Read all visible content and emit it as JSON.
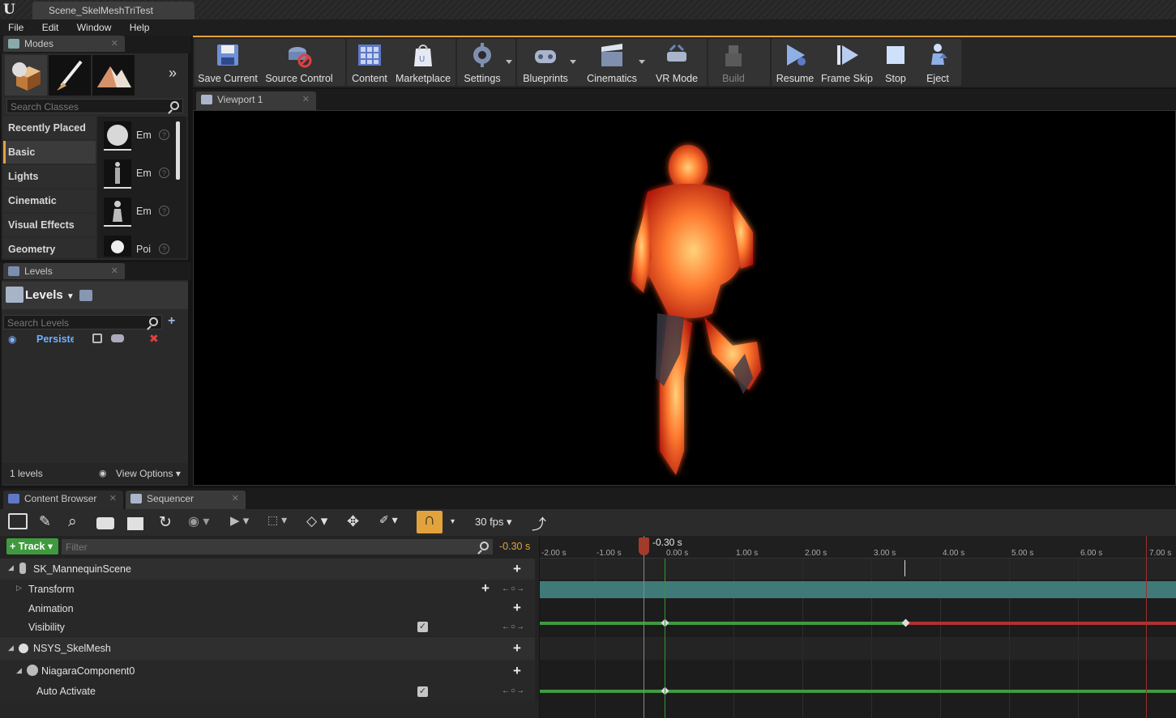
{
  "app": {
    "title": "Scene_SkelMeshTriTest"
  },
  "menu": [
    "File",
    "Edit",
    "Window",
    "Help"
  ],
  "modes": {
    "tab_label": "Modes",
    "search_placeholder": "Search Classes",
    "categories": [
      "Recently Placed",
      "Basic",
      "Lights",
      "Cinematic",
      "Visual Effects",
      "Geometry"
    ],
    "selected_category": "Basic",
    "items": [
      "Em",
      "Em",
      "Em",
      "Poi"
    ]
  },
  "levels": {
    "tab_label": "Levels",
    "header": "Levels",
    "search_placeholder": "Search Levels",
    "rows": [
      {
        "name": "Persiste"
      }
    ],
    "count": "1 levels",
    "view_options": "View Options"
  },
  "toolbar": {
    "buttons": [
      "Save Current",
      "Source Control",
      "Content",
      "Marketplace",
      "Settings",
      "Blueprints",
      "Cinematics",
      "VR Mode",
      "Build",
      "Resume",
      "Frame Skip",
      "Stop",
      "Eject"
    ]
  },
  "viewport": {
    "tab_label": "Viewport 1"
  },
  "bottom_tabs": {
    "content_browser": "Content Browser",
    "sequencer": "Sequencer"
  },
  "sequencer": {
    "fps": "30 fps",
    "add_track": "Track",
    "filter_placeholder": "Filter",
    "current_time": "-0.30 s",
    "playhead_label": "-0.30 s",
    "ruler": [
      "-2.00 s",
      "-1.00 s",
      "0.00 s",
      "1.00 s",
      "2.00 s",
      "3.00 s",
      "4.00 s",
      "5.00 s",
      "6.00 s",
      "7.00 s"
    ],
    "tracks": [
      {
        "label": "SK_MannequinScene"
      },
      {
        "label": "Transform"
      },
      {
        "label": "Animation"
      },
      {
        "label": "Visibility"
      },
      {
        "label": "NSYS_SkelMesh"
      },
      {
        "label": "NiagaraComponent0"
      },
      {
        "label": "Auto Activate"
      }
    ]
  }
}
